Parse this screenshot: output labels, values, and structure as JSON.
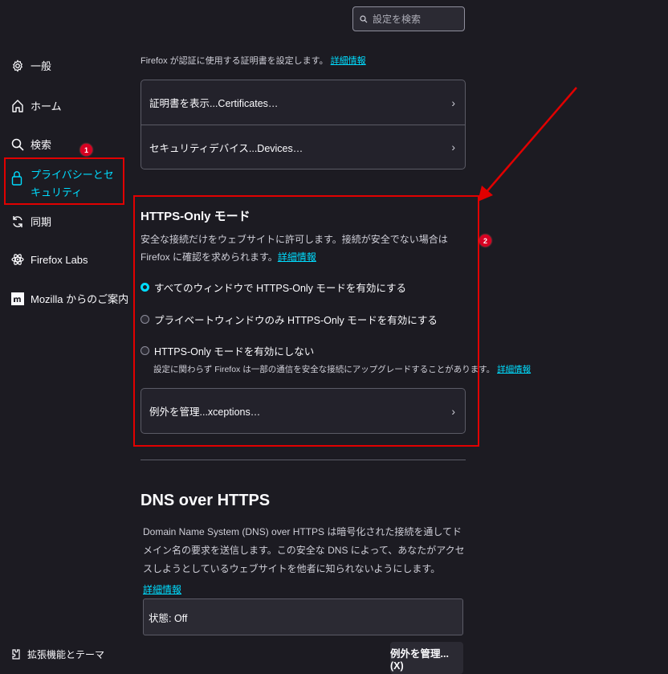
{
  "search": {
    "placeholder": "設定を検索"
  },
  "sidebar": {
    "items": [
      {
        "label": "一般",
        "icon": "gear-icon"
      },
      {
        "label": "ホーム",
        "icon": "home-icon"
      },
      {
        "label": "検索",
        "icon": "search-icon"
      },
      {
        "label": "プライバシーとセキュリティ",
        "icon": "lock-icon",
        "selected": true
      },
      {
        "label": "同期",
        "icon": "sync-icon"
      },
      {
        "label": "Firefox Labs",
        "icon": "atom-icon"
      },
      {
        "label": "Mozilla からのご案内",
        "icon": "mozilla-icon"
      }
    ],
    "footer": {
      "label": "拡張機能とテーマ",
      "icon": "puzzle-icon"
    }
  },
  "annotations": {
    "badge1": "1",
    "badge2": "2"
  },
  "certificates": {
    "description": "Firefox が認証に使用する証明書を設定します。",
    "learn_more": "詳細情報",
    "view_certificates": "証明書を表示...Certificates…",
    "security_devices": "セキュリティデバイス...Devices…"
  },
  "https_only": {
    "title": "HTTPS-Only モード",
    "description": "安全な接続だけをウェブサイトに許可します。接続が安全でない場合は Firefox に確認を求められます。",
    "learn_more": "詳細情報",
    "options": [
      "すべてのウィンドウで HTTPS-Only モードを有効にする",
      "プライベートウィンドウのみ HTTPS-Only モードを有効にする",
      "HTTPS-Only モードを有効にしない"
    ],
    "selected_index": 0,
    "note": "設定に関わらず Firefox は一部の通信を安全な接続にアップグレードすることがあります。",
    "note_link": "詳細情報",
    "manage_exceptions": "例外を管理...xceptions…"
  },
  "dns": {
    "title": "DNS over HTTPS",
    "description": "Domain Name System (DNS) over HTTPS は暗号化された接続を通してドメイン名の要求を送信します。この安全な DNS によって、あなたがアクセスしようとしているウェブサイトを他者に知られないようにします。",
    "learn_more": "詳細情報",
    "status": "状態: Off",
    "manage_exceptions_button": "例外を管理... (X)"
  },
  "colors": {
    "accent": "#00ddff",
    "annotation_red": "#e10000",
    "background": "#1c1b22"
  }
}
